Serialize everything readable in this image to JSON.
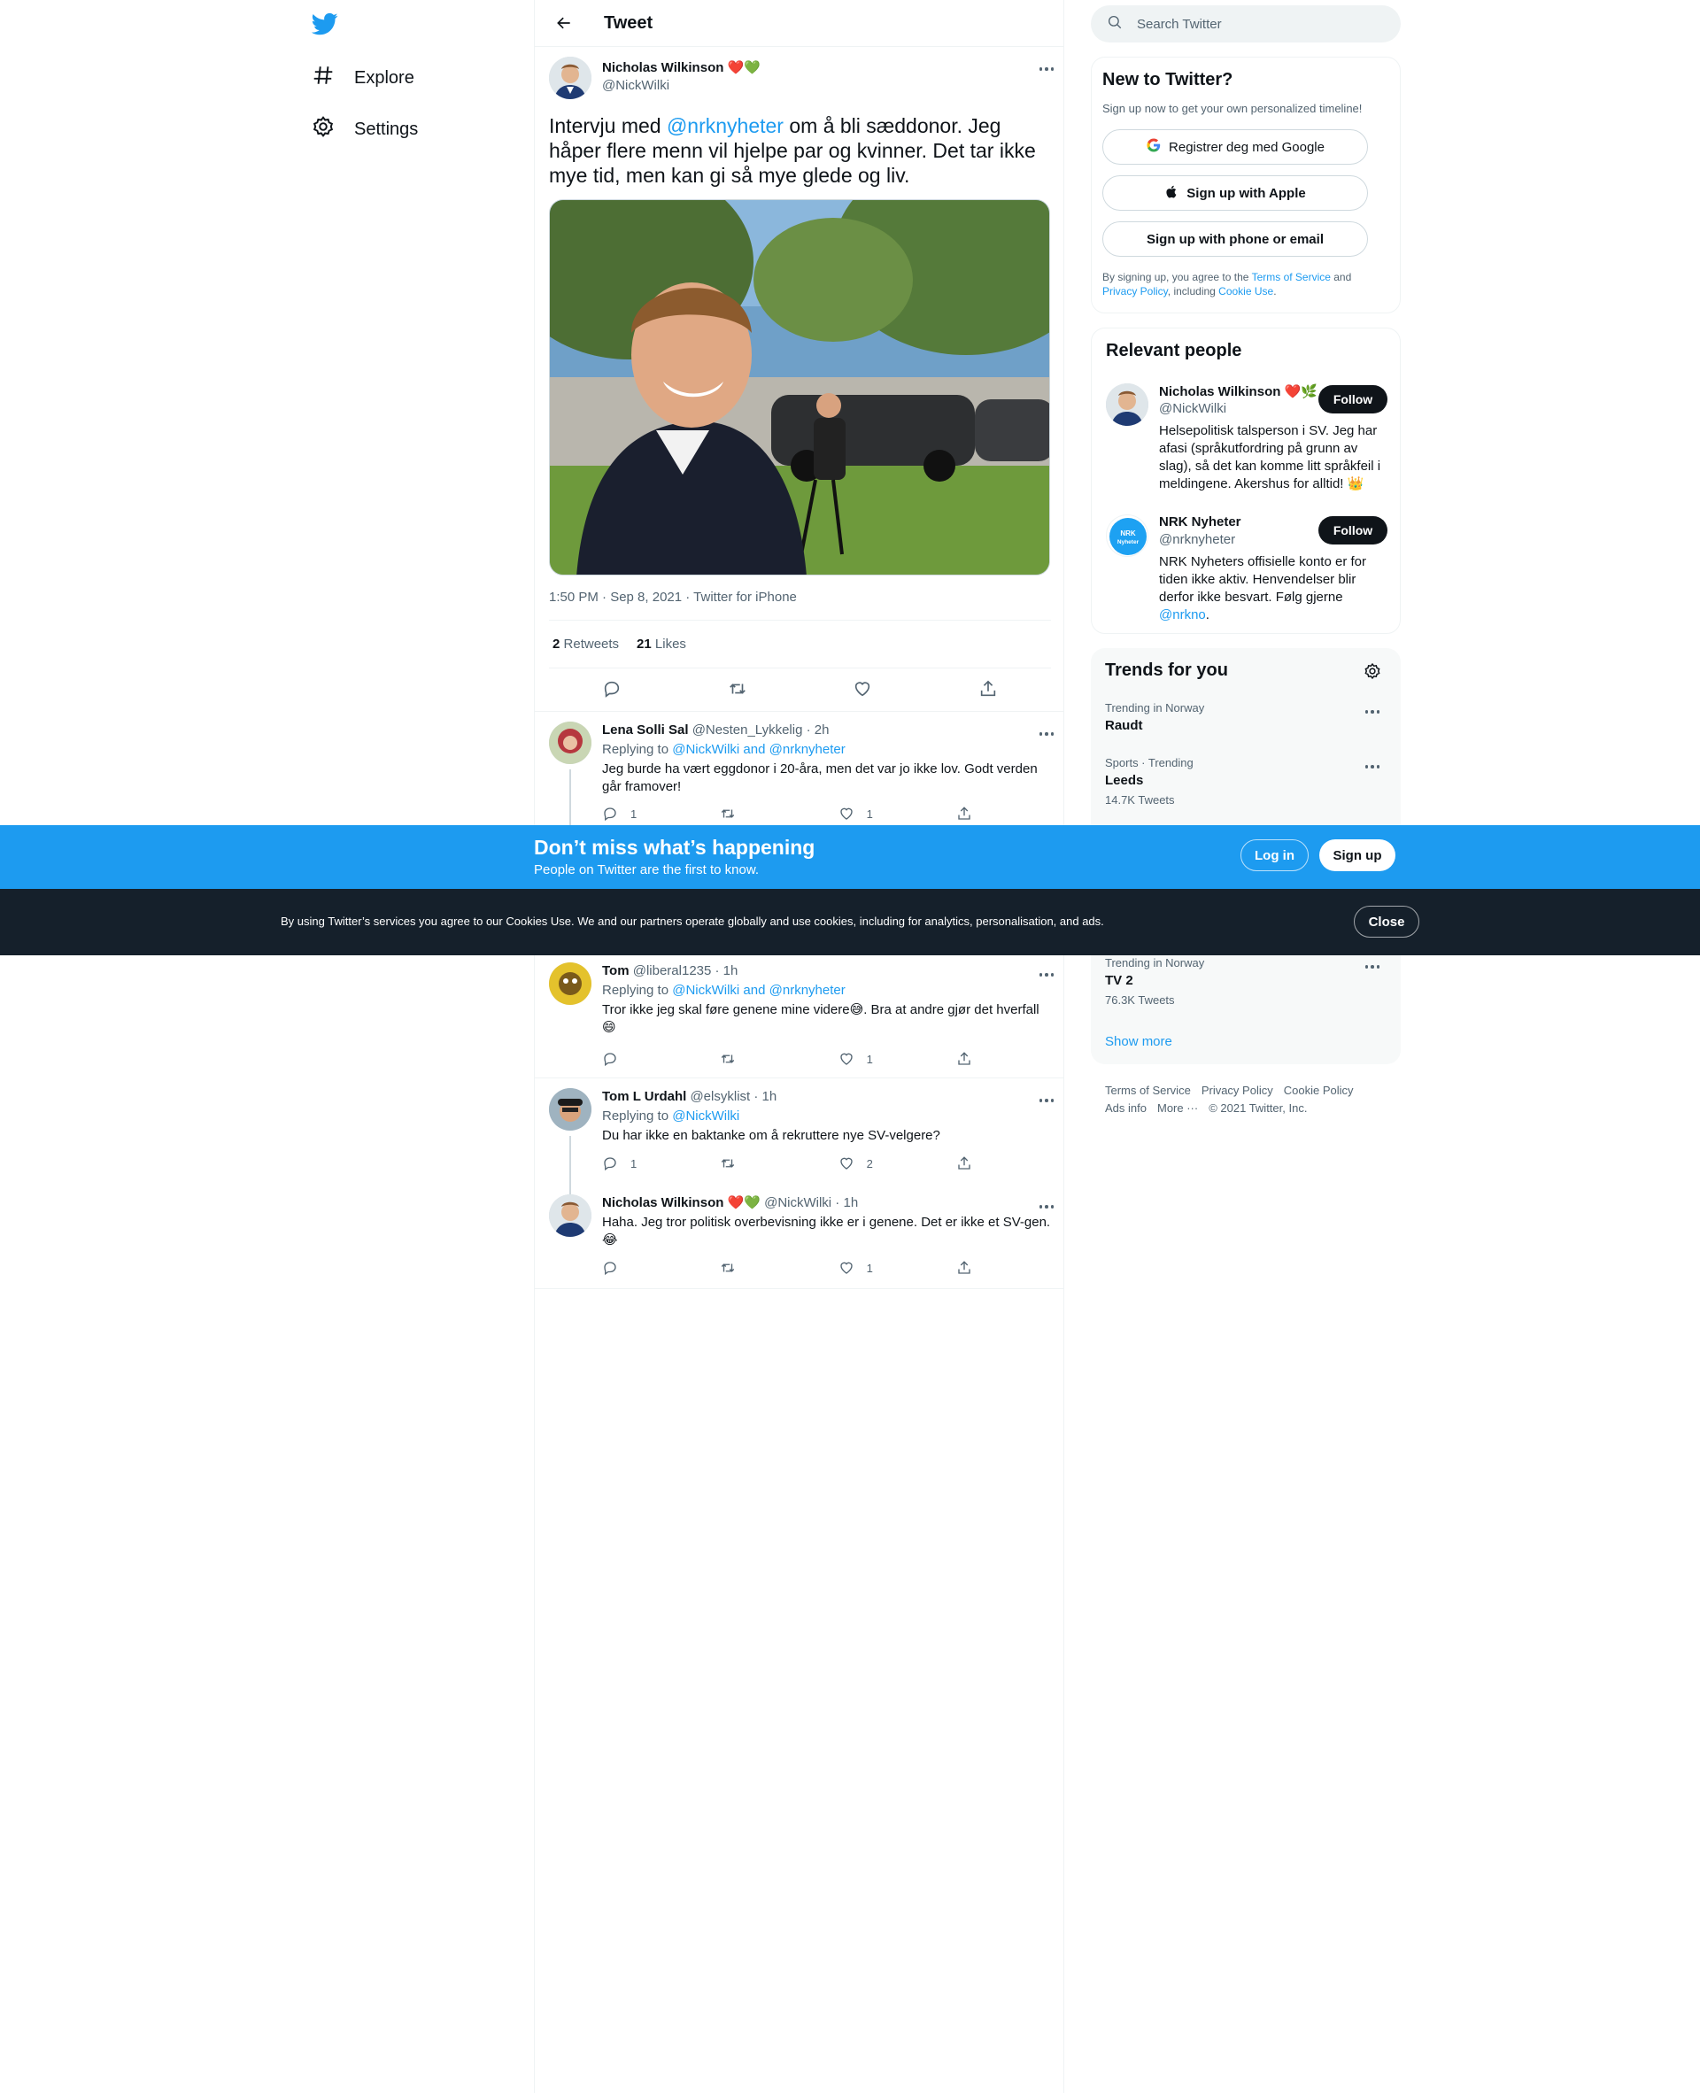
{
  "nav": {
    "explore_label": "Explore",
    "settings_label": "Settings"
  },
  "header": {
    "title": "Tweet"
  },
  "tweet": {
    "author_name": "Nicholas Wilkinson",
    "author_emoji": "❤️💚",
    "author_handle": "@NickWilki",
    "text_pre": "Intervju med ",
    "text_mention": "@nrknyheter",
    "text_post": " om å bli sæddonor. Jeg håper flere menn vil hjelpe par og kvinner. Det tar ikke mye tid, men kan gi så mye glede og liv.",
    "meta": "1:50 PM · Sep 8, 2021 · Twitter for iPhone",
    "retweets_count": "2",
    "retweets_label": "Retweets",
    "likes_count": "21",
    "likes_label": "Likes"
  },
  "replies": [
    {
      "name": "Lena Solli Sal",
      "handle_time": "@Nesten_Lykkelig · 2h",
      "replying_prefix": "Replying to ",
      "replying_to": "@NickWilki and @nrknyheter",
      "text": "Jeg burde ha vært eggdonor i 20-åra, men det var jo ikke lov. Godt verden går framover!",
      "reply_count": "1",
      "retweet_count": "",
      "like_count": "1"
    },
    {
      "name": "Tom",
      "handle_time": "@liberal1235 · 1h",
      "replying_prefix": "Replying to ",
      "replying_to": "@NickWilki and @nrknyheter",
      "text": "Tror ikke jeg skal føre genene mine videre😅. Bra at andre gjør det hverfall 😄",
      "reply_count": "",
      "retweet_count": "",
      "like_count": "1"
    },
    {
      "name": "Tom L Urdahl",
      "handle_time": "@elsyklist · 1h",
      "replying_prefix": "Replying to ",
      "replying_to": "@NickWilki",
      "text": "Du har ikke en baktanke om å rekruttere nye SV-velgere?",
      "reply_count": "1",
      "retweet_count": "",
      "like_count": "2"
    },
    {
      "name": "Nicholas Wilkinson",
      "emoji": "❤️💚",
      "handle_time": "@NickWilki · 1h",
      "text": "Haha. Jeg tror politisk overbevisning ikke er i genene. Det er ikke et SV-gen. 😂",
      "reply_count": "",
      "retweet_count": "",
      "like_count": "1"
    }
  ],
  "search": {
    "placeholder": "Search Twitter"
  },
  "new_to_twitter": {
    "title": "New to Twitter?",
    "subtitle": "Sign up now to get your own personalized timeline!",
    "google_label": "Registrer deg med Google",
    "apple_label": "Sign up with Apple",
    "phone_label": "Sign up with phone or email",
    "terms_prefix": "By signing up, you agree to the ",
    "terms_link": "Terms of Service",
    "terms_and": " and ",
    "privacy_link": "Privacy Policy",
    "terms_including": ", including ",
    "cookie_link": "Cookie Use",
    "terms_end": "."
  },
  "relevant": {
    "title": "Relevant people",
    "people": [
      {
        "name": "Nicholas Wilkinson",
        "emoji": "❤️🌿",
        "handle": "@NickWilki",
        "bio": "Helsepolitisk talsperson i SV. Jeg har afasi (språkutfordring på grunn av slag), så det kan komme litt språkfeil i meldingene. Akershus for alltid! 👑",
        "follow_label": "Follow"
      },
      {
        "name": "NRK Nyheter",
        "handle": "@nrknyheter",
        "bio_pre": "NRK Nyheters offisielle konto er for tiden ikke aktiv. Henvendelser blir derfor ikke besvart. Følg gjerne ",
        "bio_link": "@nrkno",
        "bio_post": ".",
        "follow_label": "Follow",
        "logo_text": "NRK Nyheter"
      }
    ]
  },
  "trends": {
    "title": "Trends for you",
    "items": [
      {
        "context": "Trending in Norway",
        "name": "Raudt",
        "count": ""
      },
      {
        "context": "Sports · Trending",
        "name": "Leeds",
        "count": "14.7K Tweets"
      },
      {
        "context": "Trending in Norway",
        "name": "TV 2",
        "count": "76.3K Tweets"
      }
    ],
    "show_more": "Show more"
  },
  "footer": {
    "terms": "Terms of Service",
    "privacy": "Privacy Policy",
    "cookie": "Cookie Policy",
    "ads": "Ads info",
    "more": "More ···",
    "copyright": "© 2021 Twitter, Inc."
  },
  "banner": {
    "title": "Don’t miss what’s happening",
    "subtitle": "People on Twitter are the first to know.",
    "login_label": "Log in",
    "signup_label": "Sign up"
  },
  "cookie": {
    "text": "By using Twitter’s services you agree to our Cookies Use. We and our partners operate globally and use cookies, including for analytics, personalisation, and ads.",
    "close_label": "Close"
  },
  "colors": {
    "accent": "#1d9bf0",
    "text": "#0f1419",
    "muted": "#536471",
    "cookie_bg": "#15202b"
  }
}
